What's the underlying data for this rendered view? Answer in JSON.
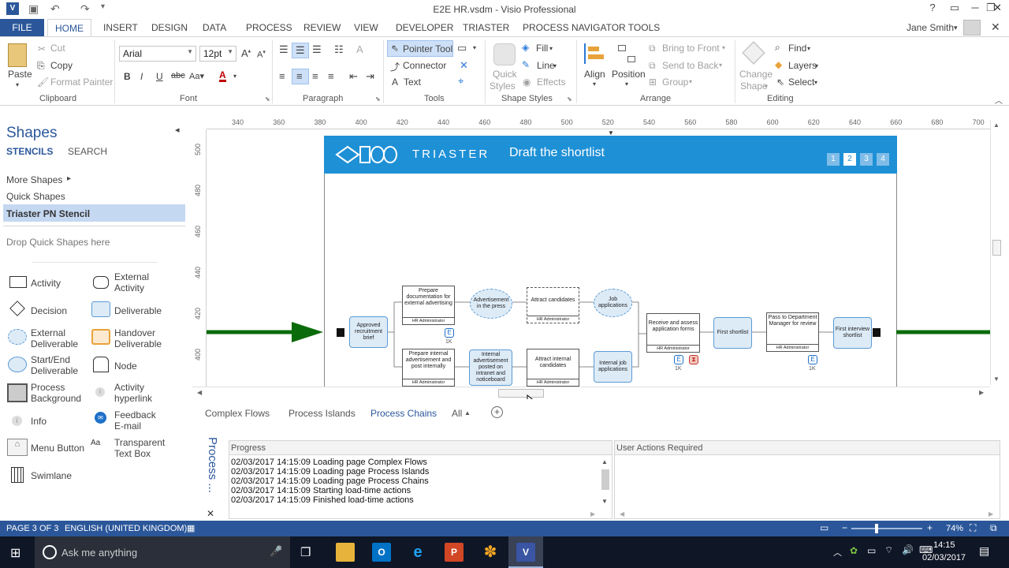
{
  "window": {
    "title": "E2E HR.vsdm - Visio Professional",
    "help": "?",
    "minimize": "─",
    "restore": "❐",
    "close": "✕"
  },
  "menu": {
    "file": "FILE",
    "tabs": [
      "HOME",
      "INSERT",
      "DESIGN",
      "DATA",
      "PROCESS",
      "REVIEW",
      "VIEW",
      "DEVELOPER",
      "TRIASTER",
      "PROCESS NAVIGATOR TOOLS"
    ],
    "user": "Jane Smith"
  },
  "ribbon": {
    "clipboard": {
      "paste": "Paste",
      "cut": "Cut",
      "copy": "Copy",
      "format_painter": "Format Painter",
      "label": "Clipboard"
    },
    "font": {
      "family": "Arial",
      "size": "12pt",
      "label": "Font"
    },
    "paragraph": {
      "label": "Paragraph"
    },
    "tools": {
      "pointer": "Pointer Tool",
      "connector": "Connector",
      "text": "Text",
      "label": "Tools"
    },
    "shape_styles": {
      "quick": "Quick",
      "styles": "Styles",
      "fill": "Fill",
      "line": "Line",
      "effects": "Effects",
      "label": "Shape Styles"
    },
    "arrange": {
      "align": "Align",
      "position": "Position",
      "bring_front": "Bring to Front",
      "send_back": "Send to Back",
      "group": "Group",
      "label": "Arrange"
    },
    "editing": {
      "change": "Change",
      "shape": "Shape",
      "find": "Find",
      "layers": "Layers",
      "select": "Select",
      "label": "Editing"
    }
  },
  "shapes": {
    "title": "Shapes",
    "stencils": "STENCILS",
    "search": "SEARCH",
    "more_shapes": "More Shapes",
    "quick_shapes": "Quick Shapes",
    "active_stencil": "Triaster PN Stencil",
    "drop_hint": "Drop Quick Shapes here",
    "items": [
      {
        "a": "Activity",
        "b": "External\nActivity"
      },
      {
        "a": "Decision",
        "b": "Deliverable"
      },
      {
        "a": "External\nDeliverable",
        "b": "Handover\nDeliverable"
      },
      {
        "a": "Start/End\nDeliverable",
        "b": "Node"
      },
      {
        "a": "Process\nBackground",
        "b": "Activity\nhyperlink"
      },
      {
        "a": "Info",
        "b": "Feedback\nE-mail"
      },
      {
        "a": "Menu Button",
        "b": "Transparent\nText Box"
      },
      {
        "a": "Swimlane",
        "b": ""
      }
    ]
  },
  "ruler": {
    "top": [
      "340",
      "360",
      "380",
      "400",
      "420",
      "440",
      "460",
      "480",
      "500",
      "520",
      "540",
      "560",
      "580",
      "600",
      "620",
      "640",
      "660",
      "680",
      "700"
    ],
    "left": [
      "500",
      "480",
      "460",
      "440",
      "420",
      "400"
    ]
  },
  "diagram": {
    "brand": "TRIASTER",
    "heading": "Draft the shortlist",
    "pages": [
      "1",
      "2",
      "3",
      "4"
    ],
    "approved": "Approved recruitment brief",
    "prep_ext": "Prepare documentation for external advertising",
    "prep_int": "Prepare internal advertisement and post internally",
    "role": "HR Administrator",
    "adv_press": "Advertisement in the press",
    "internal_adv": "Internal advertisement posted on intranet and noticeboard",
    "attract": "Attract candidates",
    "attract_int": "Attract internal candidates",
    "job_apps": "Job applications",
    "internal_apps": "Internal job applications",
    "receive": "Receive and assess application forms",
    "first_short": "First shortlist",
    "pass": "Pass to Department Manager for review",
    "first_interview": "First interview shortlist",
    "e": "E",
    "k1": "1K",
    "k2": "1K",
    "k3": "1K"
  },
  "sheet_tabs": [
    "Complex Flows",
    "Process Islands",
    "Process Chains",
    "All"
  ],
  "active_sheet": "Process Chains",
  "bottom": {
    "side_title": "Process ...",
    "progress_title": "Progress",
    "actions_title": "User Actions Required",
    "log": [
      "02/03/2017 14:15:09 Loading page Complex Flows",
      "02/03/2017 14:15:09 Loading page Process Islands",
      "02/03/2017 14:15:09 Loading page Process Chains",
      "02/03/2017 14:15:09 Starting load-time actions",
      "02/03/2017 14:15:09 Finished load-time actions"
    ]
  },
  "status": {
    "page": "PAGE 3 OF 3",
    "language": "ENGLISH (UNITED KINGDOM)",
    "zoom": "74%"
  },
  "taskbar": {
    "search": "Ask me anything",
    "time": "14:15",
    "date": "02/03/2017"
  },
  "colors": {
    "accent": "#2b579a",
    "banner": "#1e90d6",
    "arrow": "#0a6b0a"
  }
}
